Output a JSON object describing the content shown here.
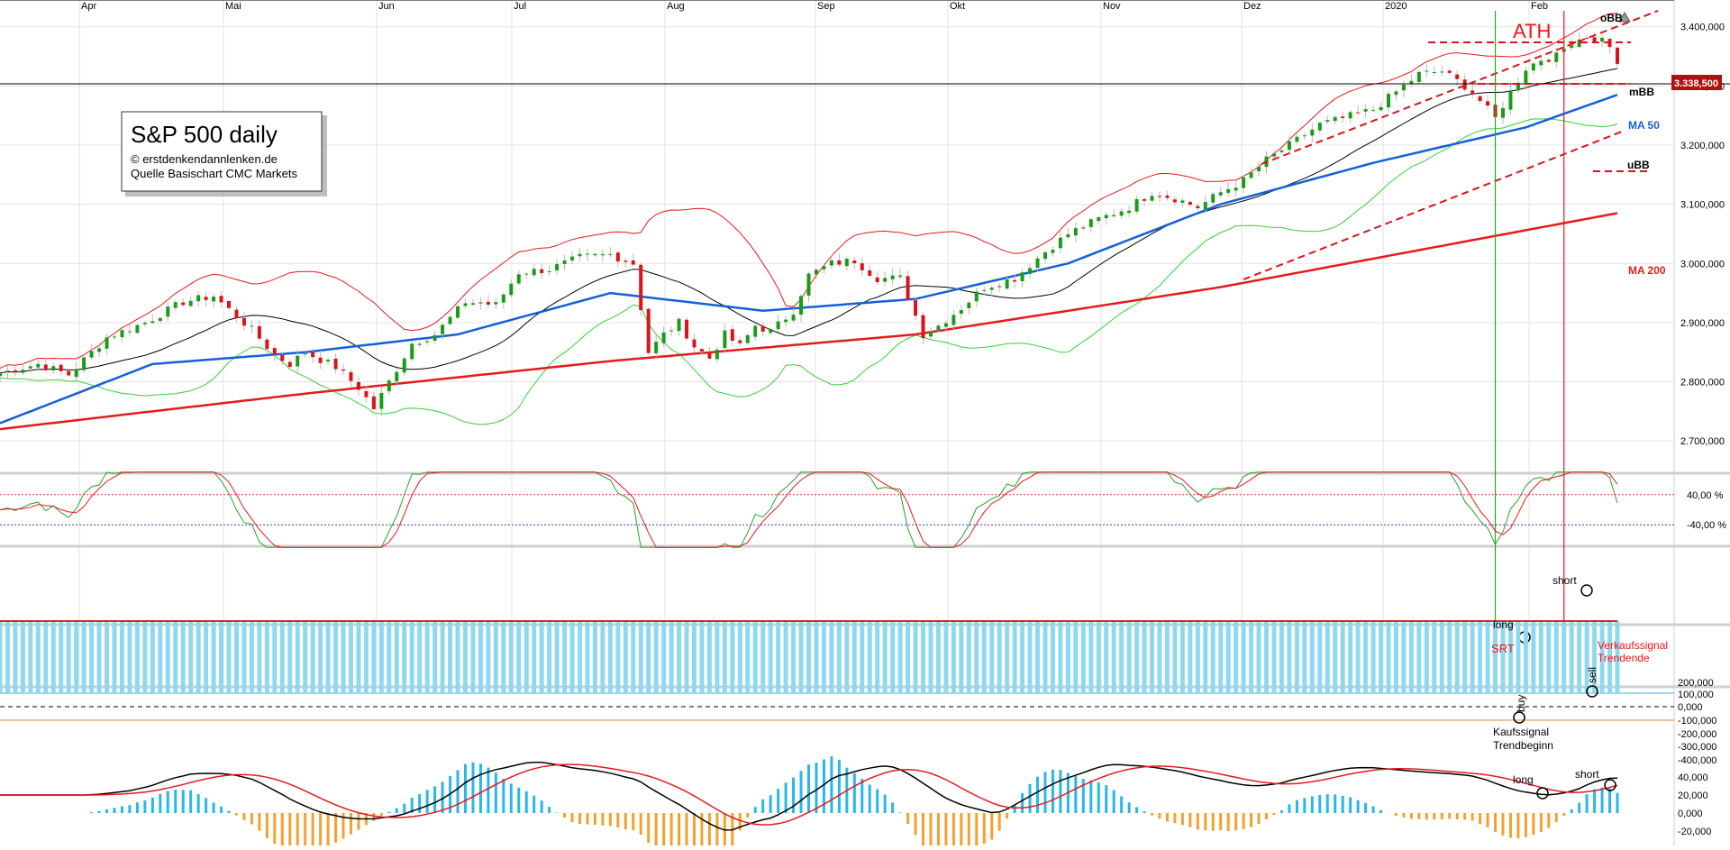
{
  "chart_data": [
    {
      "type": "candlestick",
      "title": "S&P 500 daily",
      "subtitle_lines": [
        "© erstdenkendannlenken.de",
        "Quelle Basischart CMC Markets"
      ],
      "x_labels": [
        "Apr",
        "Mai",
        "Jun",
        "Jul",
        "Aug",
        "Sep",
        "Okt",
        "Nov",
        "Dez",
        "2020",
        "Feb"
      ],
      "y_ticks": [
        "3.400,000",
        "3.300,000",
        "3.200,000",
        "3.100,000",
        "3.000,000",
        "2.900,000",
        "2.800,000",
        "2.700,000"
      ],
      "ylim": [
        2650,
        3430
      ],
      "last_price_label": "3.338,500",
      "series_labels": {
        "upper_band": "oBB",
        "middle_band": "mBB",
        "lower_band": "uBB",
        "ma50": "MA 50",
        "ma200": "MA 200"
      },
      "annotations": {
        "ath": "ATH"
      },
      "colors": {
        "up": "#1a9c1a",
        "down": "#d9141b",
        "bollinger": "#e8181e",
        "middle": "#000000",
        "lower": "#36d136",
        "ma50": "#1560d8",
        "ma200": "#e51b1b"
      },
      "close_waypoints": [
        [
          0,
          2815
        ],
        [
          5,
          2830
        ],
        [
          9,
          2812
        ],
        [
          14,
          2875
        ],
        [
          19,
          2900
        ],
        [
          24,
          2935
        ],
        [
          28,
          2945
        ],
        [
          33,
          2888
        ],
        [
          36,
          2845
        ],
        [
          38,
          2830
        ],
        [
          40,
          2850
        ],
        [
          44,
          2825
        ],
        [
          47,
          2790
        ],
        [
          49,
          2755
        ],
        [
          51,
          2800
        ],
        [
          54,
          2865
        ],
        [
          57,
          2880
        ],
        [
          61,
          2935
        ],
        [
          65,
          2930
        ],
        [
          68,
          2985
        ],
        [
          72,
          2990
        ],
        [
          76,
          3010
        ],
        [
          80,
          3015
        ],
        [
          83,
          3000
        ],
        [
          85,
          2850
        ],
        [
          87,
          2880
        ],
        [
          89,
          2900
        ],
        [
          91,
          2860
        ],
        [
          93,
          2840
        ],
        [
          95,
          2880
        ],
        [
          97,
          2860
        ],
        [
          99,
          2895
        ],
        [
          101,
          2885
        ],
        [
          104,
          2920
        ],
        [
          106,
          2980
        ],
        [
          109,
          3000
        ],
        [
          112,
          3005
        ],
        [
          115,
          2975
        ],
        [
          118,
          2975
        ],
        [
          121,
          2880
        ],
        [
          123,
          2895
        ],
        [
          126,
          2925
        ],
        [
          129,
          2960
        ],
        [
          133,
          2975
        ],
        [
          137,
          3020
        ],
        [
          140,
          3050
        ],
        [
          144,
          3075
        ],
        [
          148,
          3095
        ],
        [
          151,
          3120
        ],
        [
          154,
          3110
        ],
        [
          157,
          3095
        ],
        [
          160,
          3120
        ],
        [
          163,
          3140
        ],
        [
          166,
          3175
        ],
        [
          169,
          3200
        ],
        [
          173,
          3235
        ],
        [
          176,
          3245
        ],
        [
          180,
          3260
        ],
        [
          183,
          3290
        ],
        [
          186,
          3320
        ],
        [
          189,
          3325
        ],
        [
          192,
          3300
        ],
        [
          194,
          3275
        ],
        [
          196,
          3245
        ],
        [
          198,
          3290
        ],
        [
          200,
          3330
        ],
        [
          202,
          3345
        ],
        [
          204,
          3350
        ],
        [
          206,
          3375
        ],
        [
          208,
          3385
        ],
        [
          209,
          3370
        ],
        [
          210,
          3385
        ],
        [
          212,
          3340
        ]
      ],
      "ma200_waypoints": [
        [
          0,
          2720
        ],
        [
          40,
          2780
        ],
        [
          80,
          2835
        ],
        [
          120,
          2880
        ],
        [
          160,
          2960
        ],
        [
          212,
          3085
        ]
      ],
      "ma50_waypoints": [
        [
          0,
          2730
        ],
        [
          20,
          2830
        ],
        [
          40,
          2850
        ],
        [
          60,
          2880
        ],
        [
          80,
          2950
        ],
        [
          100,
          2920
        ],
        [
          120,
          2940
        ],
        [
          140,
          3000
        ],
        [
          160,
          3100
        ],
        [
          180,
          3170
        ],
        [
          200,
          3230
        ],
        [
          212,
          3285
        ]
      ],
      "vertical_signals": {
        "buy_index": 196,
        "sell_index": 205
      },
      "trend_lines": "dashed red channel and resistance/support lines"
    },
    {
      "type": "line",
      "name": "SRT",
      "y_ticks": [
        "40,00 %",
        "-40,00 %"
      ],
      "annotations": {
        "long": "long",
        "short": "short",
        "srt": "SRT",
        "signal1": "Verkaufssignal",
        "signal2": "Trendende"
      }
    },
    {
      "type": "area",
      "y_ticks": [
        "200,000",
        "100,000",
        "0,000",
        "-100,000",
        "-200,000",
        "-300,000",
        "-400,000"
      ],
      "annotations": {
        "buy": "buy",
        "sell": "sell",
        "sig1": "Kaufssignal",
        "sig2": "Trendbeginn"
      }
    },
    {
      "type": "histogram",
      "y_ticks": [
        "40,000",
        "20,000",
        "0,000",
        "-20,000"
      ],
      "annotations": {
        "long": "long",
        "short": "short"
      }
    }
  ]
}
